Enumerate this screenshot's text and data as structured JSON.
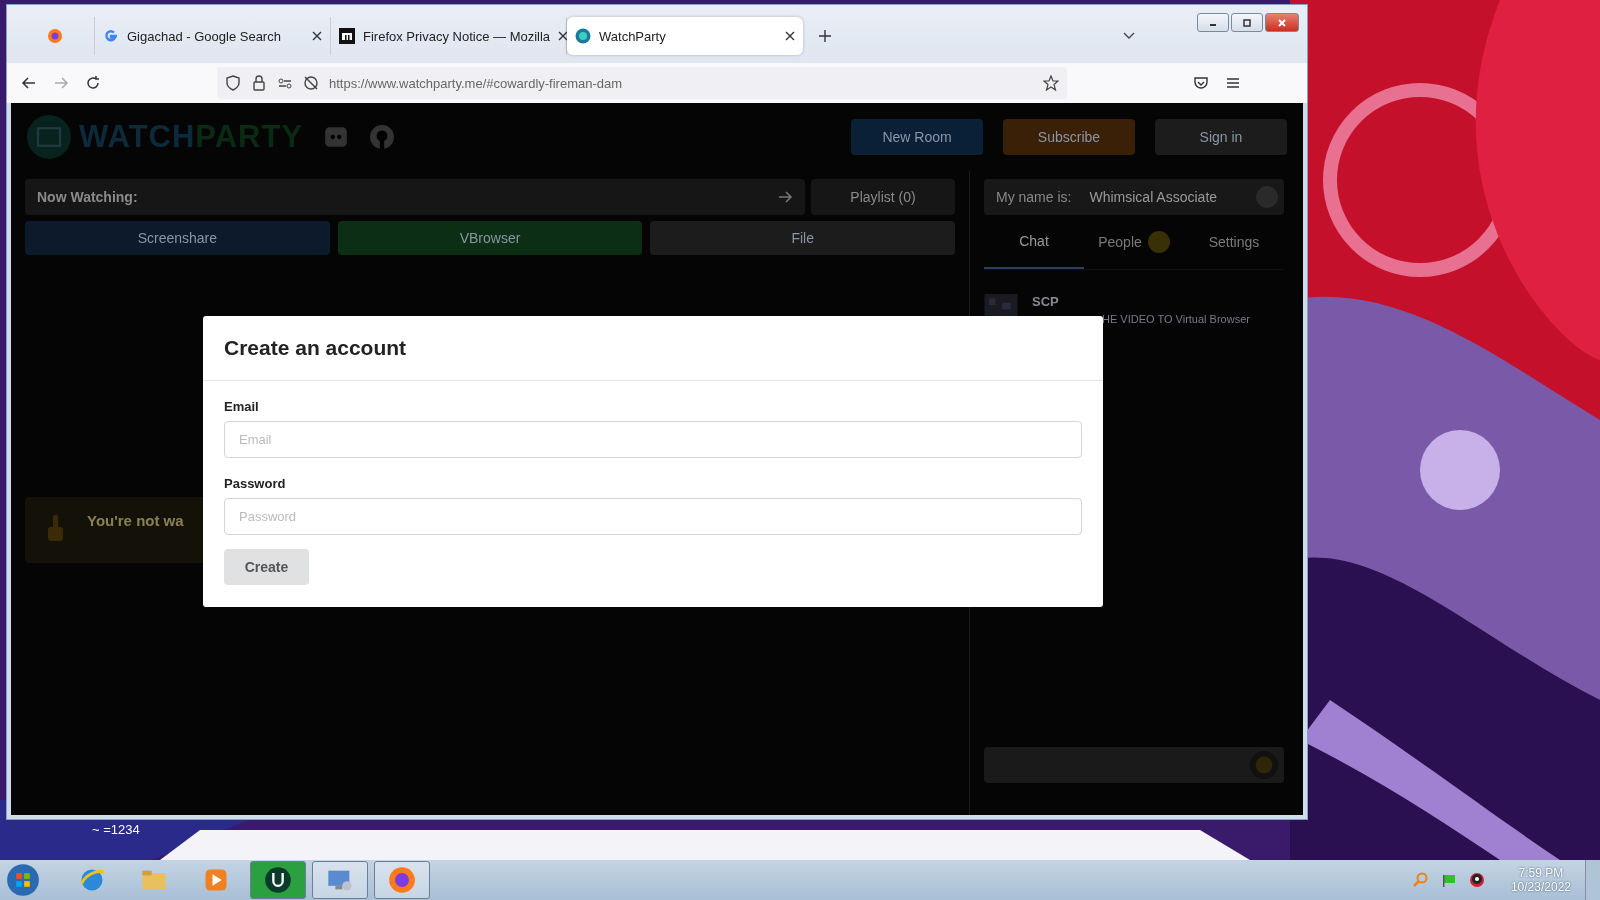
{
  "browser": {
    "tabs": [
      {
        "kind": "pinned",
        "selected": false
      },
      {
        "kind": "page",
        "title": "Gigachad - Google Search",
        "selected": false
      },
      {
        "kind": "page",
        "title": "Firefox Privacy Notice — Mozilla",
        "selected": false
      },
      {
        "kind": "page",
        "title": "WatchParty",
        "selected": true
      }
    ],
    "url": "https://www.watchparty.me/#cowardly-fireman-dam"
  },
  "page": {
    "logo_first": "WATCH",
    "logo_second": "PARTY",
    "header_buttons": [
      {
        "label": "New Room",
        "color": "#0a2036"
      },
      {
        "label": "Subscribe",
        "color": "#3a2006"
      },
      {
        "label": "Sign in",
        "color": "#1c1c1c"
      }
    ],
    "now_watching_label": "Now Watching:",
    "playlist": "Playlist (0)",
    "sources": [
      {
        "label": "Screenshare",
        "color": "#0c1a2c"
      },
      {
        "label": "VBrowser",
        "color": "#0b2e14"
      },
      {
        "label": "File",
        "color": "#1c1c1c"
      }
    ],
    "alert_title": "You're not wa",
    "sidebar": {
      "name_label": "My name is:",
      "name": "Whimsical Associate",
      "tabs": [
        {
          "label": "Chat",
          "selected": true,
          "badge": false
        },
        {
          "label": "People",
          "selected": false,
          "badge": true
        },
        {
          "label": "Settings",
          "selected": false,
          "badge": false
        }
      ],
      "messages": [
        {
          "user": "SCP",
          "text": "HE VIDEO TO Virtual Browser"
        }
      ]
    }
  },
  "modal": {
    "title": "Create an account",
    "fields": [
      {
        "label": "Email",
        "placeholder": "Email"
      },
      {
        "label": "Password",
        "placeholder": "Password"
      }
    ],
    "button": "Create"
  },
  "desktop": {
    "note": "~ =1234"
  },
  "taskbar": {
    "apps": [
      {
        "running": false
      },
      {
        "running": false
      },
      {
        "running": false
      },
      {
        "running": true
      },
      {
        "running": true
      },
      {
        "running": true
      }
    ],
    "time": "7:59 PM",
    "date": "10/23/2022"
  }
}
